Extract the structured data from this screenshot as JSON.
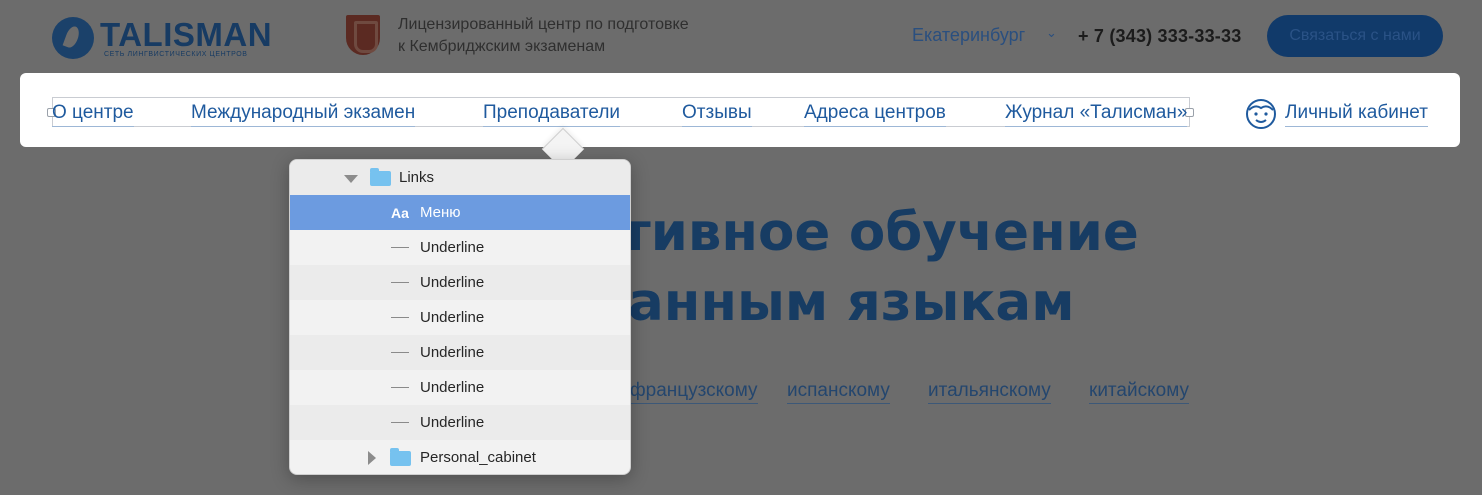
{
  "header": {
    "logo_text": "TALISMAN",
    "logo_tagline": "СЕТЬ ЛИНГВИСТИЧЕСКИХ ЦЕНТРОВ",
    "licensed_line1": "Лицензированный центр по подготовке",
    "licensed_line2": "к Кембриджским экзаменам",
    "city": "Екатеринбург",
    "phone": "+ 7 (343) 333-33-33",
    "contact_button": "Связаться с нами"
  },
  "nav": {
    "items": [
      {
        "label": "О центре"
      },
      {
        "label": "Международный экзамен"
      },
      {
        "label": "Преподаватели"
      },
      {
        "label": "Отзывы"
      },
      {
        "label": "Адреса центров"
      },
      {
        "label": "Журнал «Талисман»"
      }
    ],
    "cabinet": "Личный кабинет"
  },
  "hero": {
    "line1": "тивное обучение",
    "line2": "анным языкам",
    "languages": [
      "французскому",
      "испанскому",
      "итальянскому",
      "китайскому"
    ]
  },
  "layers": {
    "group": "Links",
    "selected": "Меню",
    "text_glyph": "Aa",
    "children": [
      "Underline",
      "Underline",
      "Underline",
      "Underline",
      "Underline",
      "Underline"
    ],
    "collapsed_group": "Personal_cabinet"
  },
  "colors": {
    "link_blue": "#1f5a9e",
    "selection": "#6c9be0",
    "folder": "#76c2ef"
  }
}
